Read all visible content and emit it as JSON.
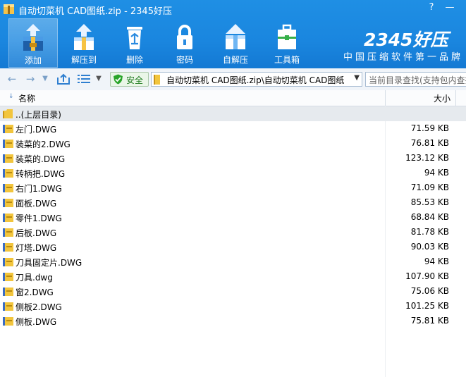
{
  "window": {
    "title": "自动切菜机 CAD图纸.zip - 2345好压",
    "controls": [
      "help-icon",
      "minimize-icon"
    ]
  },
  "toolbar": {
    "items": [
      {
        "label": "添加",
        "icon": "add-archive-icon",
        "active": true
      },
      {
        "label": "解压到",
        "icon": "extract-to-icon"
      },
      {
        "label": "删除",
        "icon": "recycle-bin-icon"
      },
      {
        "label": "密码",
        "icon": "padlock-icon"
      },
      {
        "label": "自解压",
        "icon": "self-extract-icon"
      },
      {
        "label": "工具箱",
        "icon": "toolbox-icon"
      }
    ]
  },
  "brand": {
    "logo": "2345好压",
    "slogan": "中国压缩软件第一品牌"
  },
  "addressbar": {
    "safe_label": "安全",
    "path": "自动切菜机 CAD图纸.zip\\自动切菜机 CAD图纸",
    "search_placeholder": "当前目录查找(支持包内查找)"
  },
  "columns": {
    "name": "名称",
    "size": "大小"
  },
  "parent_row": {
    "label": "..(上层目录)"
  },
  "files": [
    {
      "name": "左门.DWG",
      "size": "71.59 KB"
    },
    {
      "name": "装菜的2.DWG",
      "size": "76.81 KB"
    },
    {
      "name": "装菜的.DWG",
      "size": "123.12 KB"
    },
    {
      "name": "转柄把.DWG",
      "size": "94 KB"
    },
    {
      "name": "右门1.DWG",
      "size": "71.09 KB"
    },
    {
      "name": "面板.DWG",
      "size": "85.53 KB"
    },
    {
      "name": "零件1.DWG",
      "size": "68.84 KB"
    },
    {
      "name": "后板.DWG",
      "size": "81.78 KB"
    },
    {
      "name": "灯塔.DWG",
      "size": "90.03 KB"
    },
    {
      "name": "刀具固定片.DWG",
      "size": "94 KB"
    },
    {
      "name": "刀具.dwg",
      "size": "107.90 KB"
    },
    {
      "name": "窗2.DWG",
      "size": "75.06 KB"
    },
    {
      "name": "侧板2.DWG",
      "size": "101.25 KB"
    },
    {
      "name": "侧板.DWG",
      "size": "75.81 KB"
    }
  ],
  "colors": {
    "toolbar_blue": "#1a86df",
    "address_bg": "#f0f4f9",
    "safe_green": "#2aa52a",
    "folder_yellow": "#f2c53d"
  }
}
